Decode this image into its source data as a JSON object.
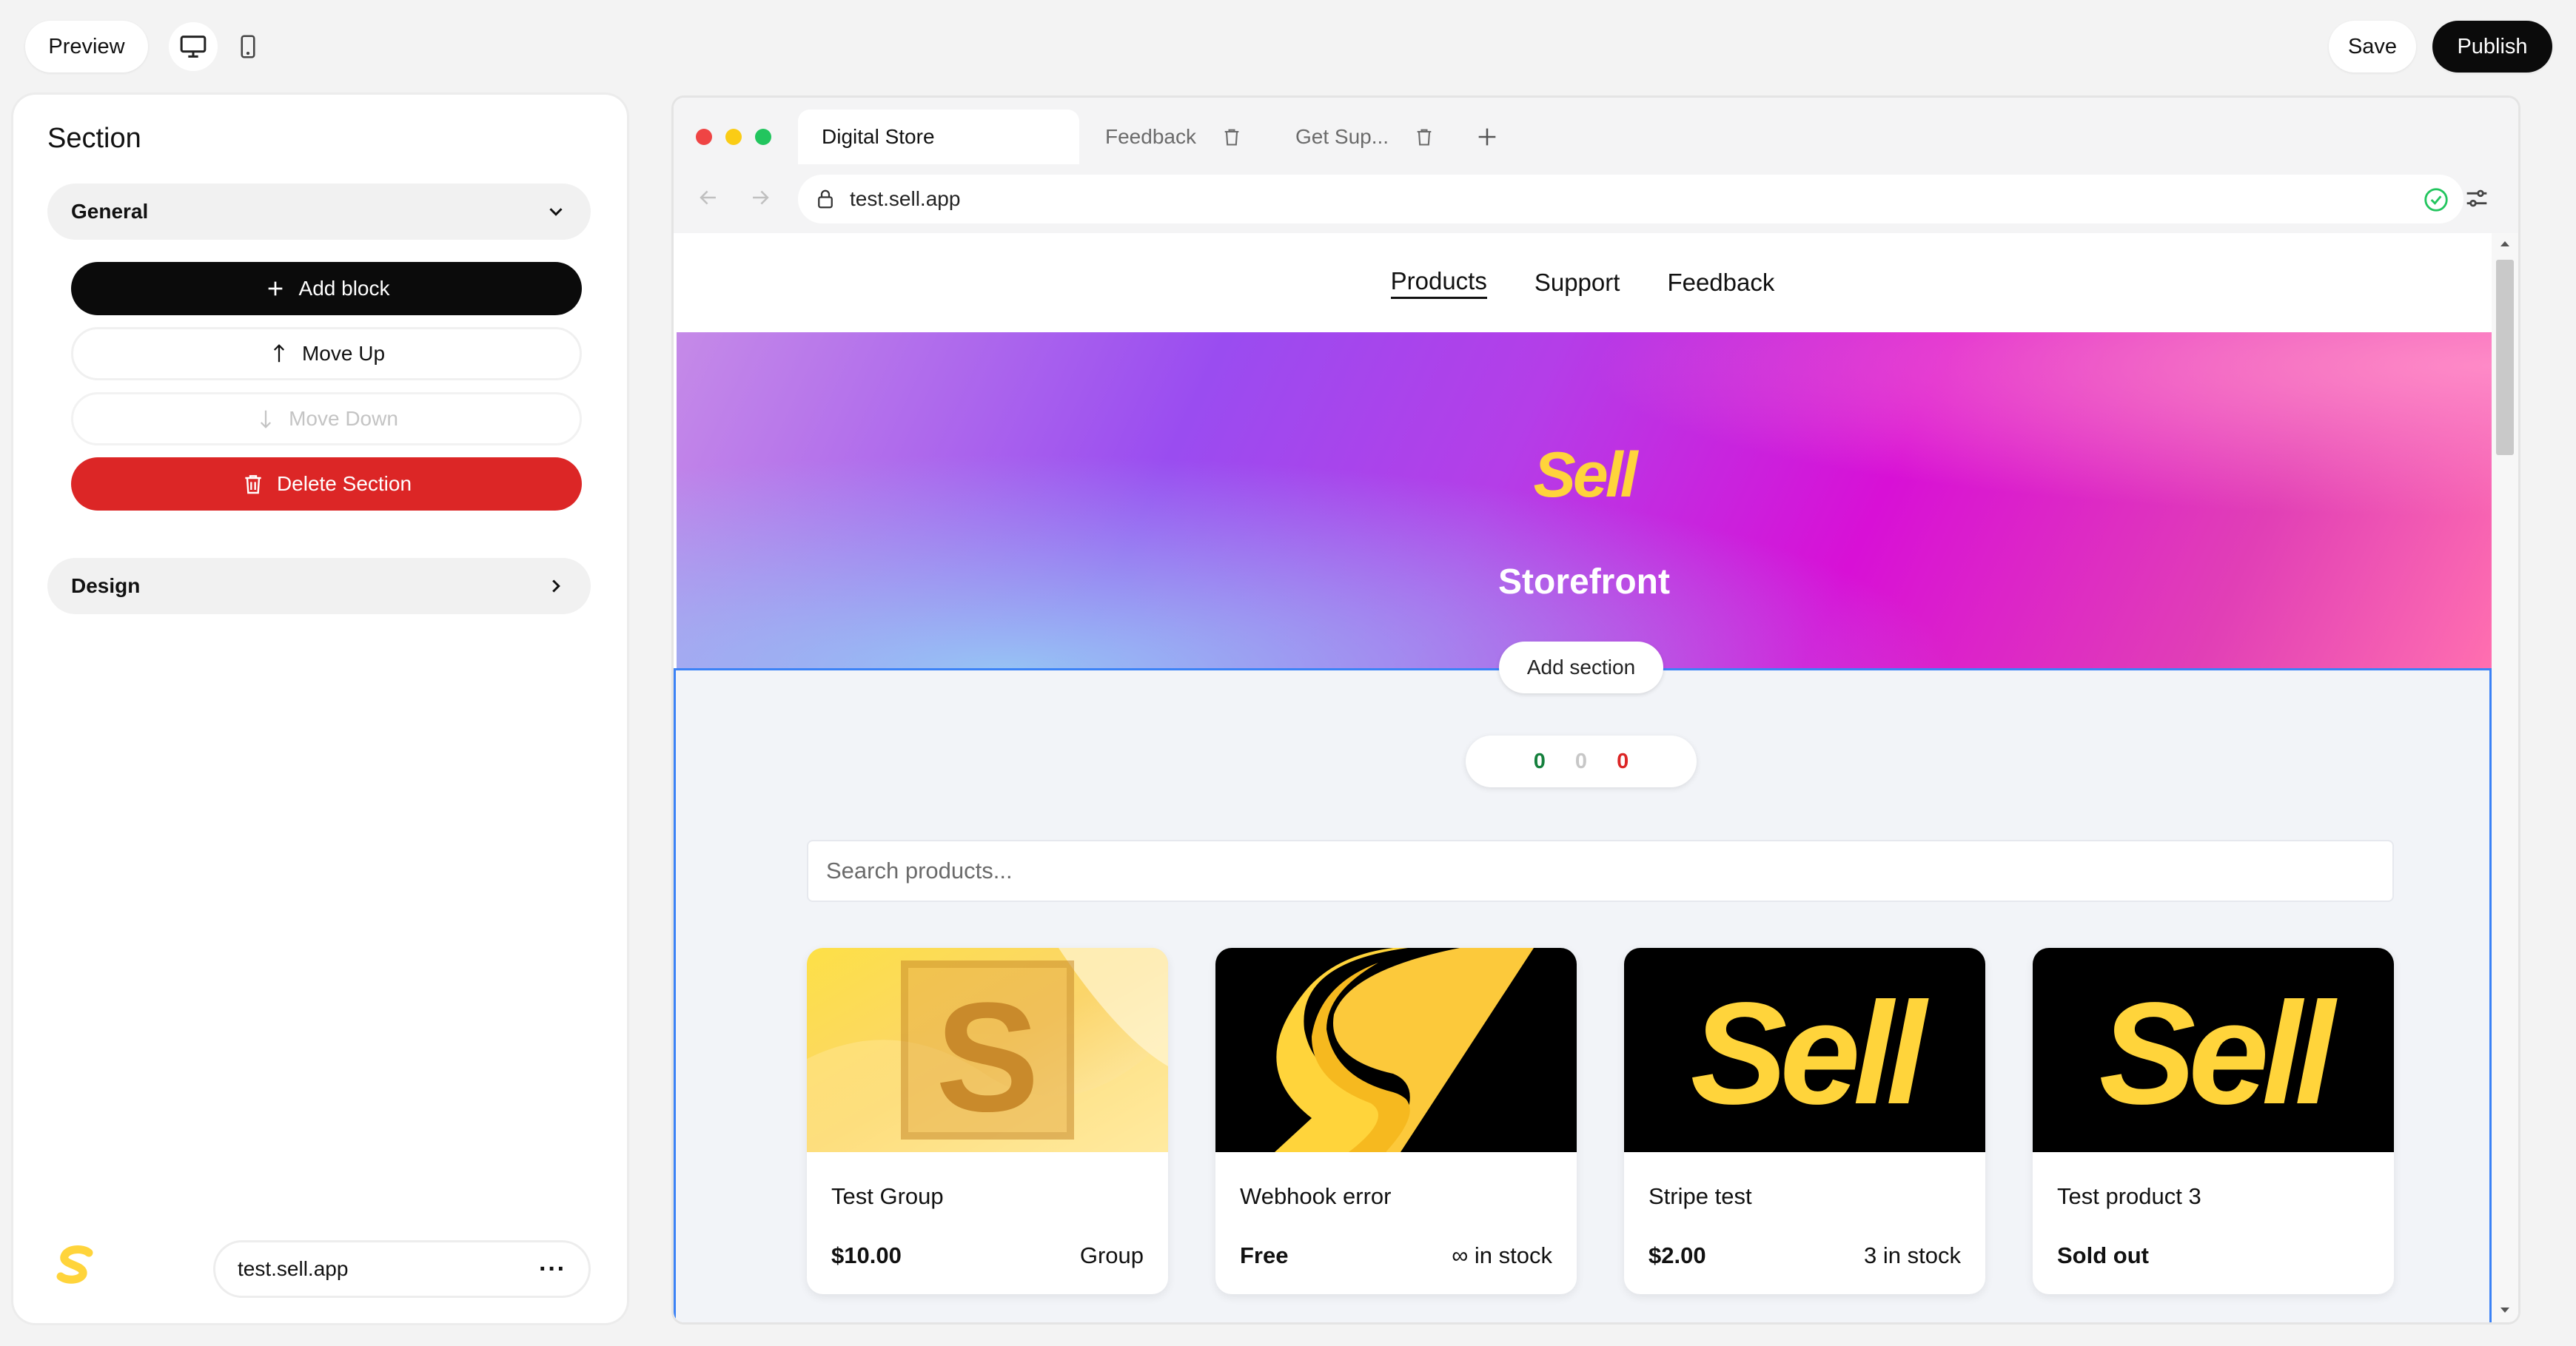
{
  "topbar": {
    "preview_label": "Preview",
    "desktop_icon": "desktop-icon",
    "mobile_icon": "mobile-icon",
    "save_label": "Save",
    "publish_label": "Publish"
  },
  "sidebar": {
    "title": "Section",
    "general_label": "General",
    "add_block_label": "Add block",
    "move_up_label": "Move Up",
    "move_down_label": "Move Down",
    "delete_section_label": "Delete Section",
    "design_label": "Design",
    "footer_domain": "test.sell.app",
    "footer_menu_label": "···"
  },
  "browser": {
    "tabs": [
      {
        "label": "Digital Store",
        "active": true
      },
      {
        "label": "Feedback",
        "active": false
      },
      {
        "label": "Get Sup...",
        "active": false
      }
    ],
    "url": "test.sell.app"
  },
  "store": {
    "nav": [
      "Products",
      "Support",
      "Feedback"
    ],
    "hero_logo": "Sell",
    "hero_title": "Storefront",
    "add_section_label": "Add section",
    "counter": {
      "green": "0",
      "gray": "0",
      "red": "0"
    },
    "search_placeholder": "Search products...",
    "products": [
      {
        "name": "Test Group",
        "price": "$10.00",
        "stock": "Group"
      },
      {
        "name": "Webhook error",
        "price": "Free",
        "stock": "∞ in stock"
      },
      {
        "name": "Stripe test",
        "price": "$2.00",
        "stock": "3 in stock"
      },
      {
        "name": "Test product 3",
        "price": "Sold out",
        "stock": ""
      }
    ],
    "card_logo_text": "Sell",
    "card_s_text": "S"
  },
  "colors": {
    "accent_blue": "#3b82f6",
    "danger_red": "#dc2626",
    "brand_yellow": "#ffd43b",
    "counter_green": "#15803d",
    "counter_gray": "#c7c7c7",
    "counter_red": "#dc2626"
  }
}
